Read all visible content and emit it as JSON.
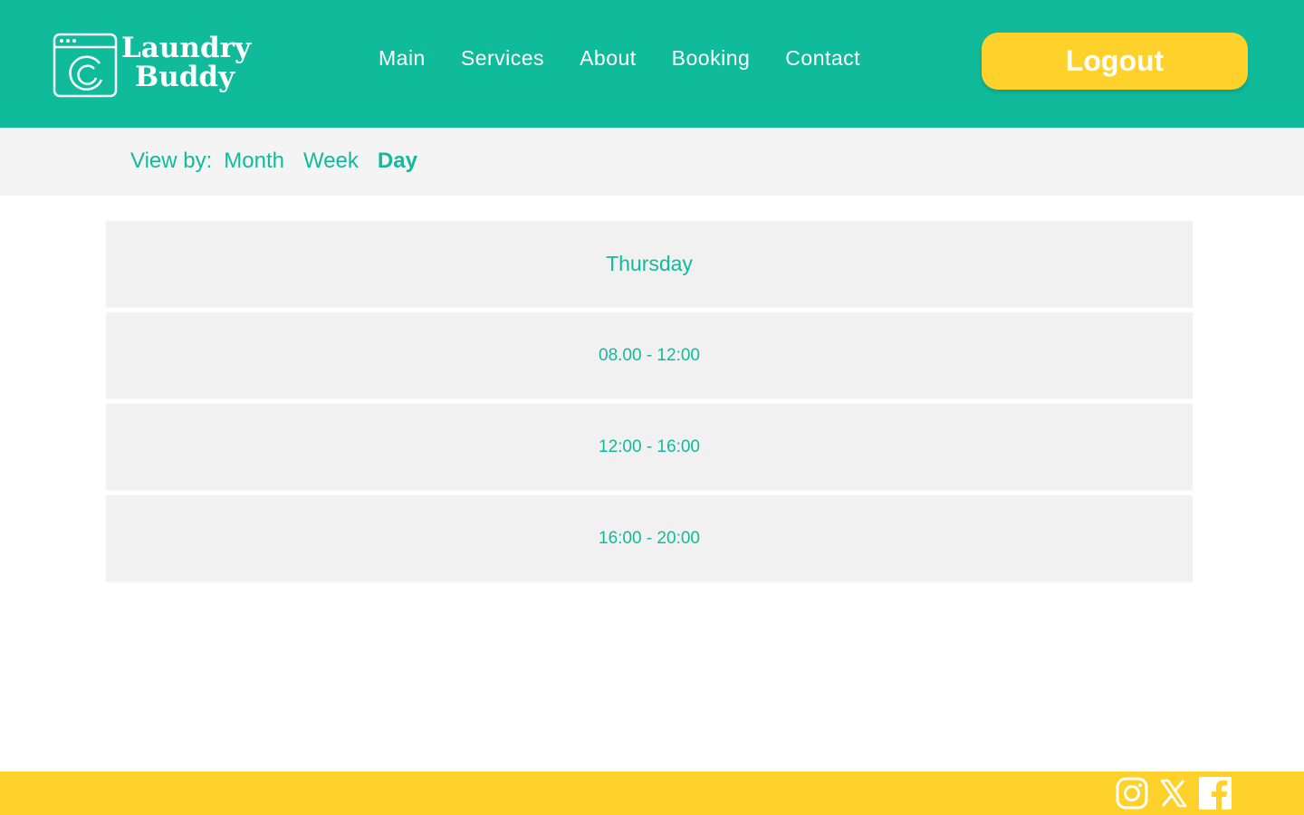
{
  "brand": {
    "line1": "Laundry",
    "line2": "Buddy",
    "icon": "washing-machine-icon"
  },
  "nav": {
    "items": [
      "Main",
      "Services",
      "About",
      "Booking",
      "Contact"
    ]
  },
  "header": {
    "logout_label": "Logout"
  },
  "view": {
    "label": "View by:",
    "options": [
      "Month",
      "Week",
      "Day"
    ],
    "active": "Day"
  },
  "schedule": {
    "day": "Thursday",
    "slots": [
      "08.00 - 12:00",
      "12:00 - 16:00",
      "16:00 - 20:00"
    ]
  },
  "footer": {
    "social_icons": [
      "instagram-icon",
      "x-icon",
      "facebook-icon"
    ]
  },
  "colors": {
    "primary": "#10bb9c",
    "accent": "#ffd12b",
    "panel": "#f1f1f1",
    "viewbar": "#f4f4f4"
  }
}
